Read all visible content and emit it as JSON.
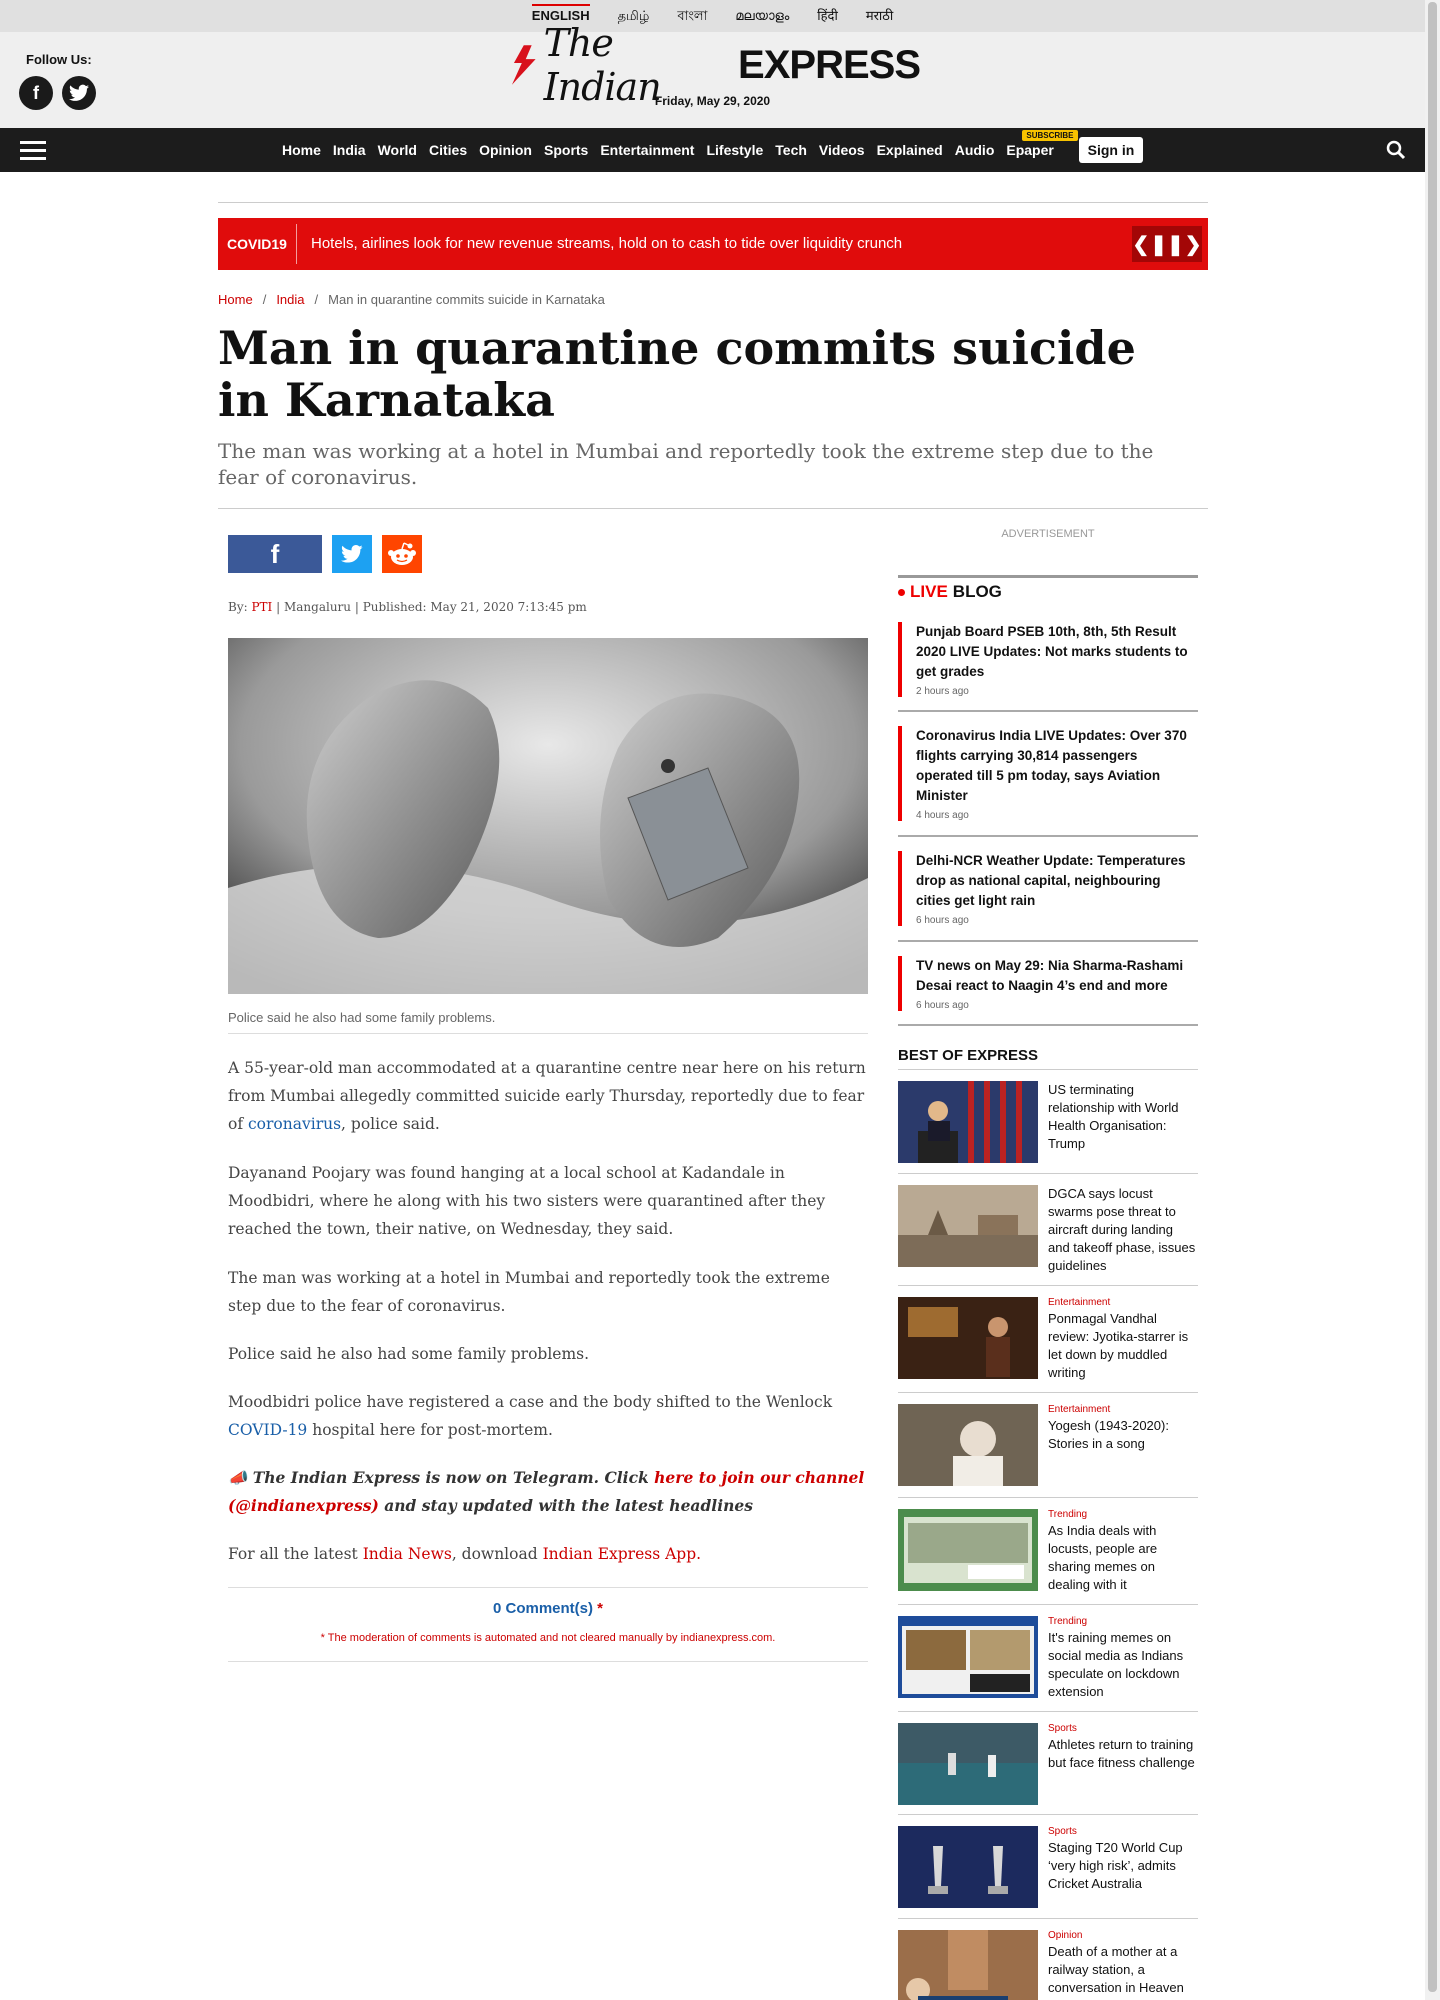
{
  "languages": [
    "ENGLISH",
    "தமிழ்",
    "বাংলা",
    "മലയാളം",
    "हिंदी",
    "मराठी"
  ],
  "masthead": {
    "follow_label": "Follow Us:",
    "logo_the": "The Indian",
    "logo_express": "EXPRESS",
    "date": "Friday, May 29, 2020"
  },
  "nav": {
    "links": [
      "Home",
      "India",
      "World",
      "Cities",
      "Opinion",
      "Sports",
      "Entertainment",
      "Lifestyle",
      "Tech",
      "Videos",
      "Explained",
      "Audio"
    ],
    "epaper": "Epaper",
    "subscribe": "SUBSCRIBE",
    "signin": "Sign in"
  },
  "ticker": {
    "tag": "COVID19",
    "headline": "Hotels, airlines look for new revenue streams, hold on to cash to tide over liquidity crunch"
  },
  "breadcrumb": [
    "Home",
    "India",
    "Man in quarantine commits suicide in Karnataka"
  ],
  "article": {
    "title": "Man in quarantine commits suicide in Karnataka",
    "subtitle": "The man was working at a hotel in Mumbai and reportedly took the extreme step due to the fear of coronavirus.",
    "by_label": "By:",
    "author": "PTI",
    "location": "Mangaluru",
    "published": "Published: May 21, 2020 7:13:45 pm",
    "caption": "Police said he also had some family problems.",
    "p1_a": "A 55-year-old man accommodated at a quarantine centre near here on his return from Mumbai allegedly committed suicide early Thursday, reportedly due to fear of ",
    "p1_link": "coronavirus",
    "p1_b": ", police said.",
    "p2": "Dayanand Poojary was found hanging at a local school at Kadandale in Moodbidri, where he along with his two sisters were quarantined after they reached the town, their native, on Wednesday, they said.",
    "p3": "The man was working at a hotel in Mumbai and reportedly took the extreme step due to the fear of coronavirus.",
    "p4": "Police said he also had some family problems.",
    "p5_a": "Moodbidri police have registered a case and the body shifted to the Wenlock ",
    "p5_link": "COVID-19",
    "p5_b": " hospital here for post-mortem.",
    "tg_a": "📣 The Indian Express is now on Telegram. Click ",
    "tg_link": "here to join our channel (@indianexpress)",
    "tg_b": " and stay updated with the latest headlines",
    "latest_a": "For all the latest ",
    "latest_link1": "India News",
    "latest_b": ", download ",
    "latest_link2": "Indian Express App.",
    "comments": "0 Comment(s)",
    "comments_star": "*",
    "mod_note": "* The moderation of comments is automated and not cleared manually by indianexpress.com."
  },
  "sidebar": {
    "ad_label": "ADVERTISEMENT",
    "live_label": "LIVE",
    "blog_label": "BLOG",
    "live_items": [
      {
        "title": "Punjab Board PSEB 10th, 8th, 5th Result 2020 LIVE Updates: Not marks students to get grades",
        "ago": "2 hours ago"
      },
      {
        "title": "Coronavirus India LIVE Updates: Over 370 flights carrying 30,814 passengers operated till 5 pm today, says Aviation Minister",
        "ago": "4 hours ago"
      },
      {
        "title": "Delhi-NCR Weather Update: Temperatures drop as national capital, neighbouring cities get light rain",
        "ago": "6 hours ago"
      },
      {
        "title": "TV news on May 29: Nia Sharma-Rashami Desai react to Naagin 4’s end and more",
        "ago": "6 hours ago"
      }
    ],
    "best_label": "BEST OF EXPRESS",
    "best_items": [
      {
        "cat": "",
        "title": "US terminating relationship with World Health Organisation: Trump"
      },
      {
        "cat": "",
        "title": "DGCA says locust swarms pose threat to aircraft during landing and takeoff phase, issues guidelines"
      },
      {
        "cat": "Entertainment",
        "title": "Ponmagal Vandhal review: Jyotika-starrer is let down by muddled writing"
      },
      {
        "cat": "Entertainment",
        "title": "Yogesh (1943-2020): Stories in a song"
      },
      {
        "cat": "Trending",
        "title": "As India deals with locusts, people are sharing memes on dealing with it"
      },
      {
        "cat": "Trending",
        "title": "It's raining memes on social media as Indians speculate on lockdown extension"
      },
      {
        "cat": "Sports",
        "title": "Athletes return to training but face fitness challenge"
      },
      {
        "cat": "Sports",
        "title": "Staging T20 World Cup ‘very high risk’, admits Cricket Australia"
      },
      {
        "cat": "Opinion",
        "title": "Death of a mother at a railway station, a conversation in Heaven"
      }
    ]
  },
  "colors": {
    "brand_red": "#e00c0c",
    "link_blue": "#1a5fa8",
    "nav_bg": "#1c1c1c"
  }
}
